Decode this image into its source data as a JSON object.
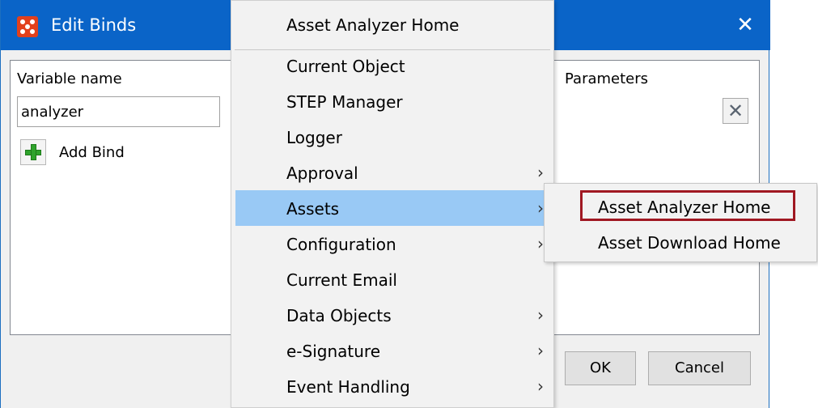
{
  "window": {
    "title": "Edit Binds",
    "close_glyph": "✕",
    "app_icon": "app-logo-icon"
  },
  "left_panel": {
    "variable_label": "Variable name",
    "variable_value": "analyzer",
    "add_bind_label": "Add Bind"
  },
  "right_panel": {
    "parameters_label": "Parameters",
    "remove_glyph": "✕"
  },
  "buttons": {
    "ok": "OK",
    "cancel": "Cancel"
  },
  "menu": {
    "header": "Asset Analyzer Home",
    "items": [
      {
        "label": "Current Object",
        "submenu": false
      },
      {
        "label": "STEP Manager",
        "submenu": false
      },
      {
        "label": "Logger",
        "submenu": false
      },
      {
        "label": "Approval",
        "submenu": true
      },
      {
        "label": "Assets",
        "submenu": true,
        "highlighted": true
      },
      {
        "label": "Configuration",
        "submenu": true
      },
      {
        "label": "Current Email",
        "submenu": false
      },
      {
        "label": "Data Objects",
        "submenu": true
      },
      {
        "label": "e-Signature",
        "submenu": true
      },
      {
        "label": "Event Handling",
        "submenu": true
      }
    ],
    "arrow_glyph": "›"
  },
  "submenu": {
    "items": [
      {
        "label": "Asset Analyzer Home",
        "outlined": true
      },
      {
        "label": "Asset Download Home",
        "outlined": false
      }
    ]
  },
  "colors": {
    "titlebar": "#0a64c8",
    "highlight": "#99c9f5",
    "outline": "#a01822"
  }
}
